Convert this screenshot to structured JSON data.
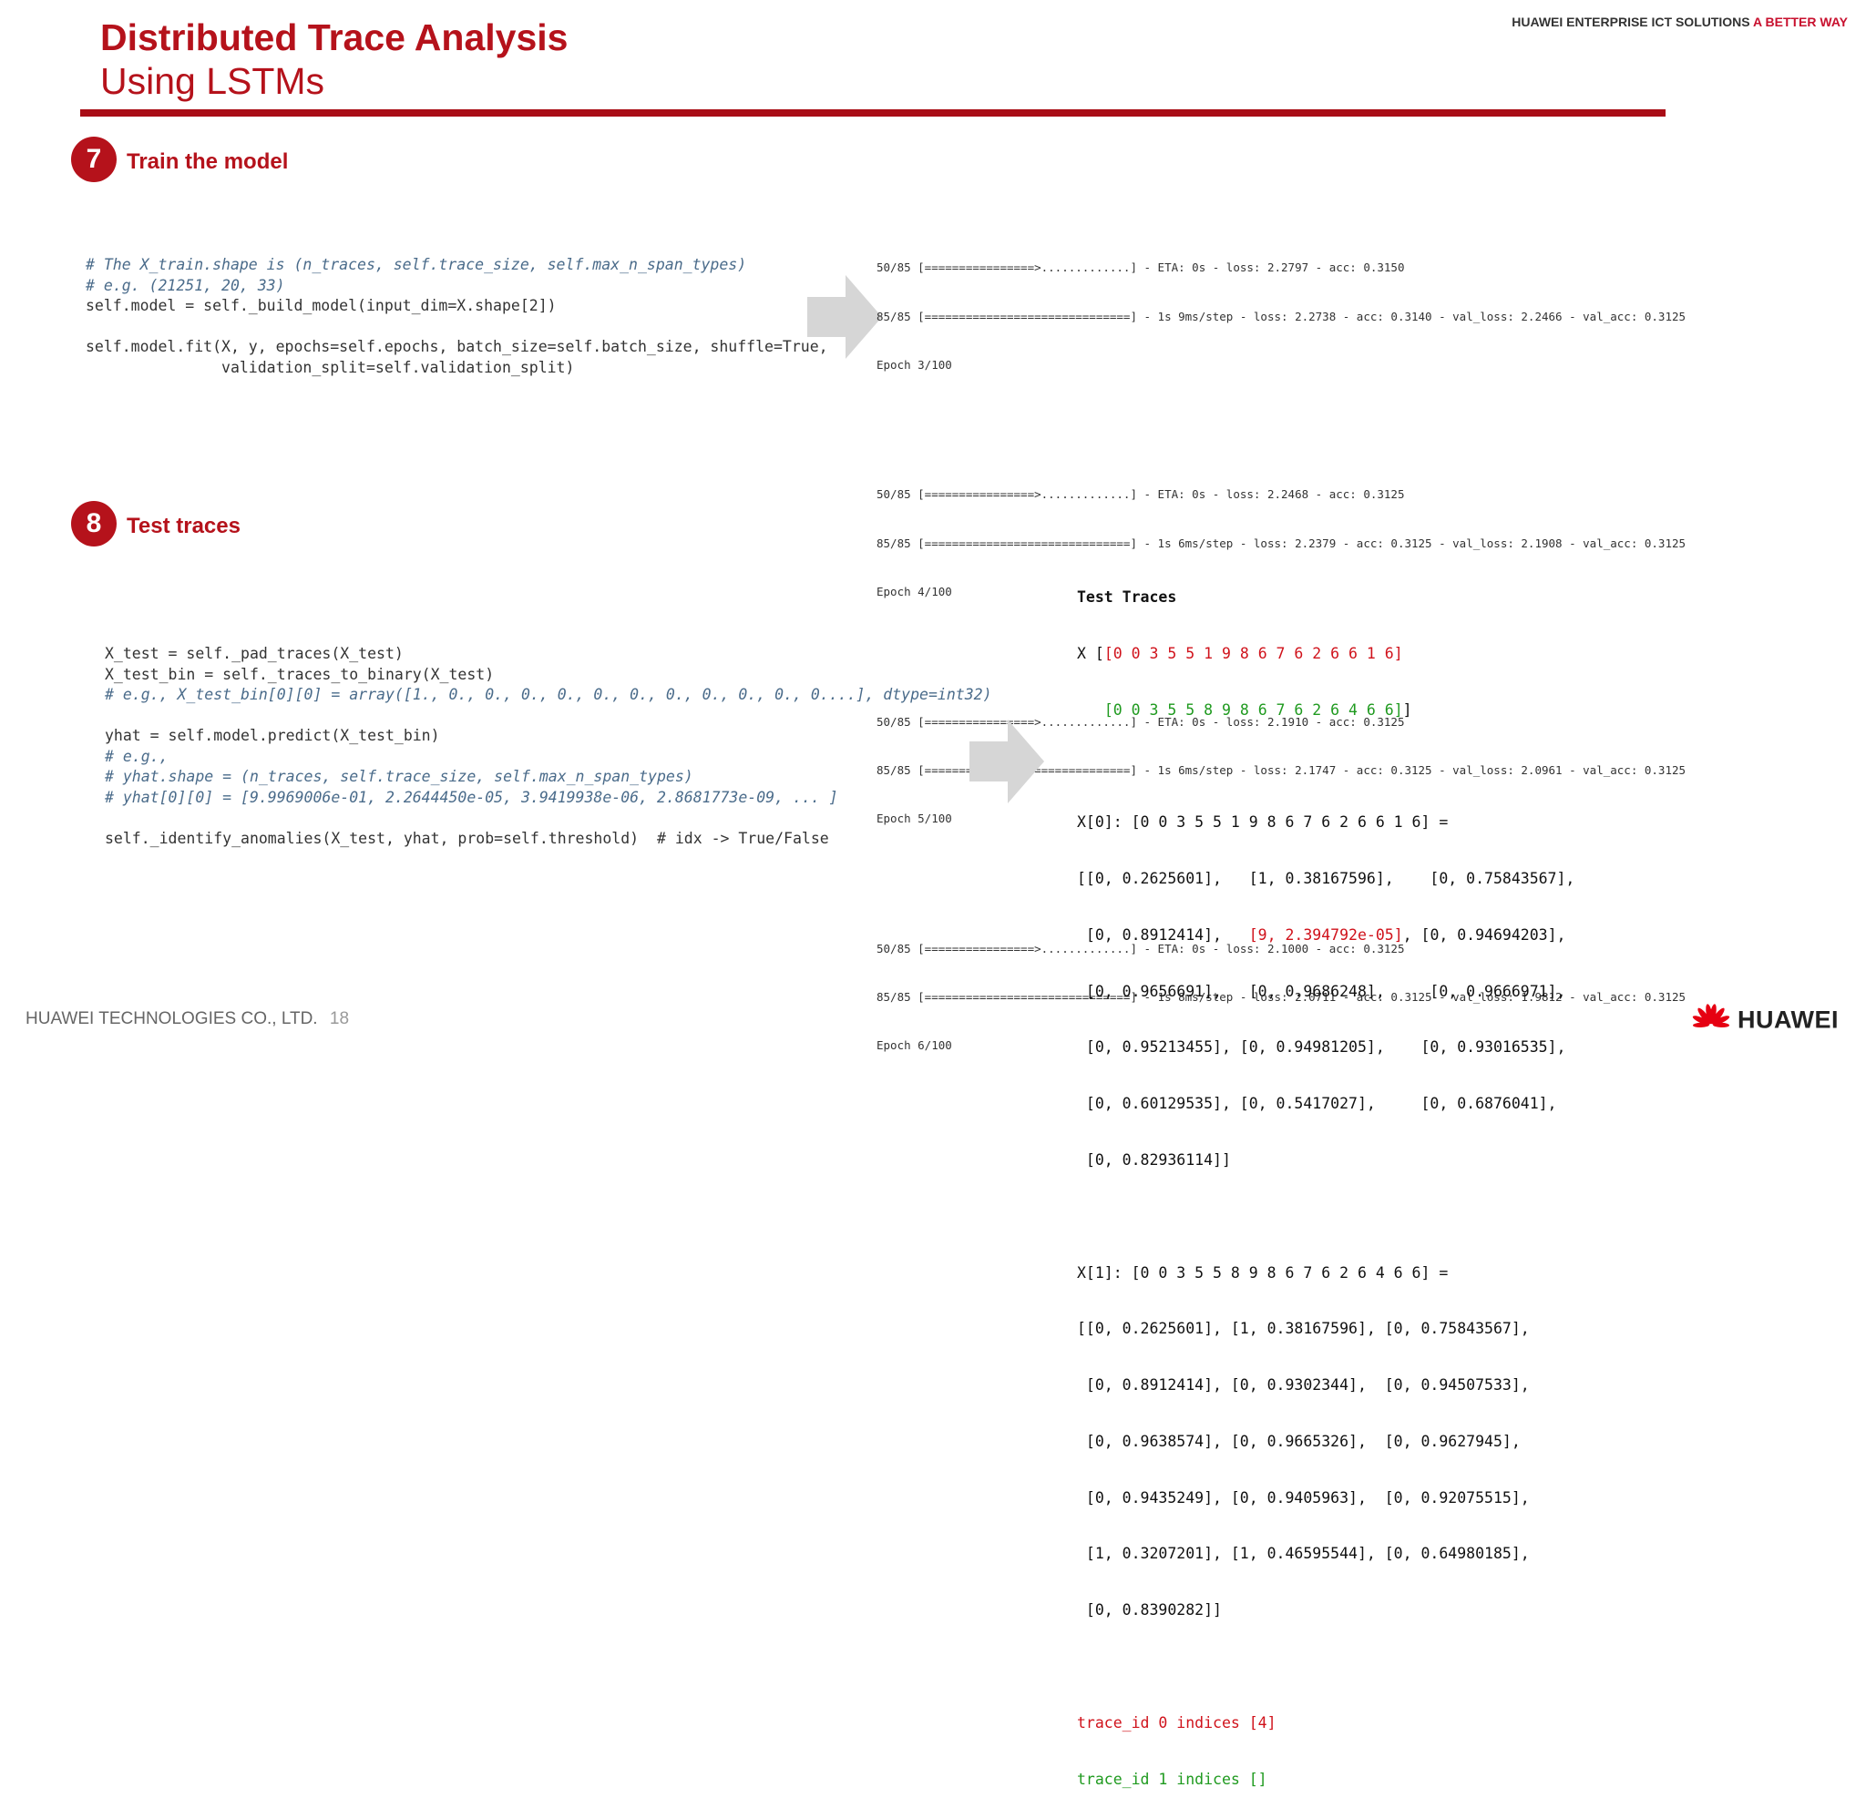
{
  "header": {
    "title": "Distributed Trace Analysis",
    "subtitle": "Using LSTMs",
    "brand_text": "HUAWEI ENTERPRISE ICT SOLUTIONS",
    "brand_accent": "A BETTER WAY"
  },
  "colors": {
    "accent": "#b5121b",
    "rule": "#a90d16",
    "code_comment": "#4a6b8a",
    "code_keyword": "#2a5bc7",
    "output_red": "#d0121b",
    "output_green": "#1f9a1f"
  },
  "step7": {
    "number": "7",
    "label": "Train the model",
    "code": [
      "# The X_train.shape is (n_traces, self.trace_size, self.max_n_span_types)",
      "# e.g. (21251, 20, 33)",
      "self.model = self._build_model(input_dim=X.shape[2])",
      "",
      "self.model.fit(X, y, epochs=self.epochs, batch_size=self.batch_size, shuffle=True,",
      "               validation_split=self.validation_split)"
    ],
    "log_blocks": [
      {
        "line1": "50/85 [================>.............] - ETA: 0s - loss: 2.2797 - acc: 0.3150",
        "line2": "85/85 [==============================] - 1s 9ms/step - loss: 2.2738 - acc: 0.3140 - val_loss: 2.2466 - val_acc: 0.3125",
        "epoch": "Epoch 3/100"
      },
      {
        "line1": "50/85 [================>.............] - ETA: 0s - loss: 2.2468 - acc: 0.3125",
        "line2": "85/85 [==============================] - 1s 6ms/step - loss: 2.2379 - acc: 0.3125 - val_loss: 2.1908 - val_acc: 0.3125",
        "epoch": "Epoch 4/100"
      },
      {
        "line1": "50/85 [================>.............] - ETA: 0s - loss: 2.1910 - acc: 0.3125",
        "line2": "85/85 [==============================] - 1s 6ms/step - loss: 2.1747 - acc: 0.3125 - val_loss: 2.0961 - val_acc: 0.3125",
        "epoch": "Epoch 5/100"
      },
      {
        "line1": "50/85 [================>.............] - ETA: 0s - loss: 2.1000 - acc: 0.3125",
        "line2": "85/85 [==============================] - 1s 8ms/step - loss: 2.0711 - acc: 0.3125 - val_loss: 1.9812 - val_acc: 0.3125",
        "epoch": "Epoch 6/100"
      }
    ]
  },
  "step8": {
    "number": "8",
    "label": "Test traces",
    "code": [
      "X_test = self._pad_traces(X_test)",
      "X_test_bin = self._traces_to_binary(X_test)",
      "# e.g., X_test_bin[0][0] = array([1., 0., 0., 0., 0., 0., 0., 0., 0., 0., 0., 0....], dtype=int32)",
      "",
      "yhat = self.model.predict(X_test_bin)",
      "# e.g.,",
      "# yhat.shape = (n_traces, self.trace_size, self.max_n_span_types)",
      "# yhat[0][0] = [9.9969006e-01, 2.2644450e-05, 3.9419938e-06, 2.8681773e-09, ... ]",
      "",
      "self._identify_anomalies(X_test, yhat, prob=self.threshold)  # idx -> True/False"
    ],
    "output": {
      "heading": "Test Traces",
      "x_prefix": "X [",
      "x_row1": "[0 0 3 5 5 1 9 8 6 7 6 2 6 6 1 6]",
      "x_row2": "[0 0 3 5 5 8 9 8 6 7 6 2 6 4 6 6]",
      "x_close": "]",
      "x0_header": "X[0]: [0 0 3 5 5 1 9 8 6 7 6 2 6 6 1 6] =",
      "x0_line1": "[[0, 0.2625601],   [1, 0.38167596],    [0, 0.75843567],",
      "x0_line2_a": " [0, 0.8912414],   ",
      "x0_line2_b": "[9, 2.394792e-05]",
      "x0_line2_c": ", [0, 0.94694203],",
      "x0_line3": " [0, 0.9656691],   [0, 0.9686248],     [0, 0.9666971],",
      "x0_line4": " [0, 0.95213455], [0, 0.94981205],    [0, 0.93016535],",
      "x0_line5": " [0, 0.60129535], [0, 0.5417027],     [0, 0.6876041],",
      "x0_line6": " [0, 0.82936114]]",
      "x1_header": "X[1]: [0 0 3 5 5 8 9 8 6 7 6 2 6 4 6 6] =",
      "x1_lines": [
        "[[0, 0.2625601], [1, 0.38167596], [0, 0.75843567],",
        " [0, 0.8912414], [0, 0.9302344],  [0, 0.94507533],",
        " [0, 0.9638574], [0, 0.9665326],  [0, 0.9627945],",
        " [0, 0.9435249], [0, 0.9405963],  [0, 0.92075515],",
        " [1, 0.3207201], [1, 0.46595544], [0, 0.64980185],",
        " [0, 0.8390282]]"
      ],
      "result1": "trace_id 0 indices [4]",
      "result2": "trace_id 1 indices []"
    }
  },
  "footer": {
    "company": "HUAWEI TECHNOLOGIES CO., LTD.",
    "page_number": "18",
    "logo_text": "HUAWEI"
  }
}
